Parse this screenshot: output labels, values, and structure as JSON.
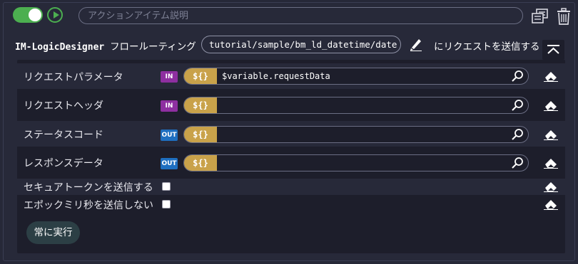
{
  "header": {
    "description_placeholder": "アクションアイテム説明",
    "description_value": ""
  },
  "action": {
    "title_prefix": "IM-LogicDesigner",
    "title_suffix": "フロールーティング",
    "path": "tutorial/sample/bm_ld_datetime/date",
    "send_label": "にリクエストを送信する"
  },
  "params": [
    {
      "label": "リクエストパラメータ",
      "direction": "IN",
      "prefix": "${}",
      "value": "$variable.requestData"
    },
    {
      "label": "リクエストヘッダ",
      "direction": "IN",
      "prefix": "${}",
      "value": ""
    },
    {
      "label": "ステータスコード",
      "direction": "OUT",
      "prefix": "${}",
      "value": ""
    },
    {
      "label": "レスポンスデータ",
      "direction": "OUT",
      "prefix": "${}",
      "value": ""
    }
  ],
  "options": [
    {
      "label": "セキュアトークンを送信する",
      "checked": false
    },
    {
      "label": "エポックミリ秒を送信しない",
      "checked": false
    }
  ],
  "always_run_label": "常に実行",
  "colors": {
    "toggle_on": "#4caf50",
    "badge_in": "#8e2fa0",
    "badge_out": "#1e6fc0",
    "var_prefix": "#c9a24a"
  }
}
